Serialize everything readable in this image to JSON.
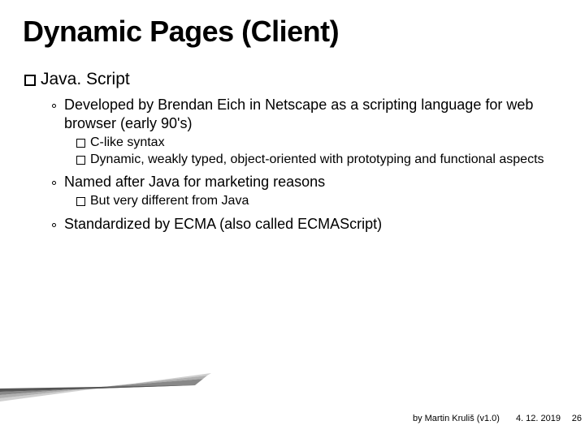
{
  "title": "Dynamic Pages (Client)",
  "heading": "Java. Script",
  "points": {
    "p1": "Developed by Brendan Eich in Netscape as a scripting language for web browser (early 90's)",
    "p1a": "C-like syntax",
    "p1b": "Dynamic, weakly typed, object-oriented with prototyping and functional aspects",
    "p2": "Named after Java for marketing reasons",
    "p2a": "But very different from Java",
    "p3": "Standardized by ECMA (also called ECMAScript)"
  },
  "footer": {
    "author": "by Martin Kruliš (v1.0)",
    "date": "4. 12. 2019",
    "page": "26"
  }
}
